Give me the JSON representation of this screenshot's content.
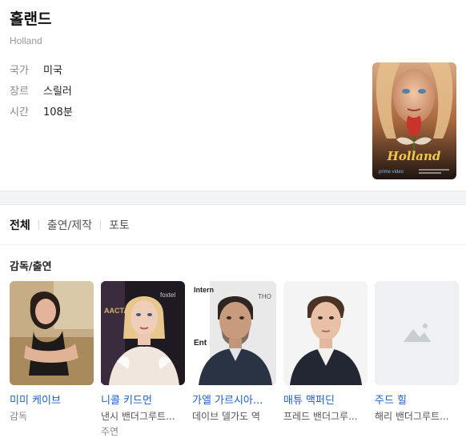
{
  "header": {
    "title": "홀랜드",
    "subtitle": "Holland"
  },
  "info": [
    {
      "label": "국가",
      "value": "미국"
    },
    {
      "label": "장르",
      "value": "스릴러"
    },
    {
      "label": "시간",
      "value": "108분"
    }
  ],
  "poster": {
    "title_text": "Holland",
    "service_text": "prime video"
  },
  "tabs": [
    {
      "label": "전체",
      "active": true
    },
    {
      "label": "출연/제작",
      "active": false
    },
    {
      "label": "포토",
      "active": false
    }
  ],
  "section": {
    "title": "감독/출연"
  },
  "cast": [
    {
      "name": "미미 케이브",
      "role": "감독",
      "role2": ""
    },
    {
      "name": "니콜 키드먼",
      "role": "낸시 밴더그루트...",
      "role2": "주연"
    },
    {
      "name": "가엘 가르시아...",
      "role": "데이브 델가도 역",
      "role2": ""
    },
    {
      "name": "매튜 맥퍼딘",
      "role": "프레드 밴더그루...",
      "role2": ""
    },
    {
      "name": "주드 힐",
      "role": "해리 밴더그루트...",
      "role2": ""
    }
  ]
}
